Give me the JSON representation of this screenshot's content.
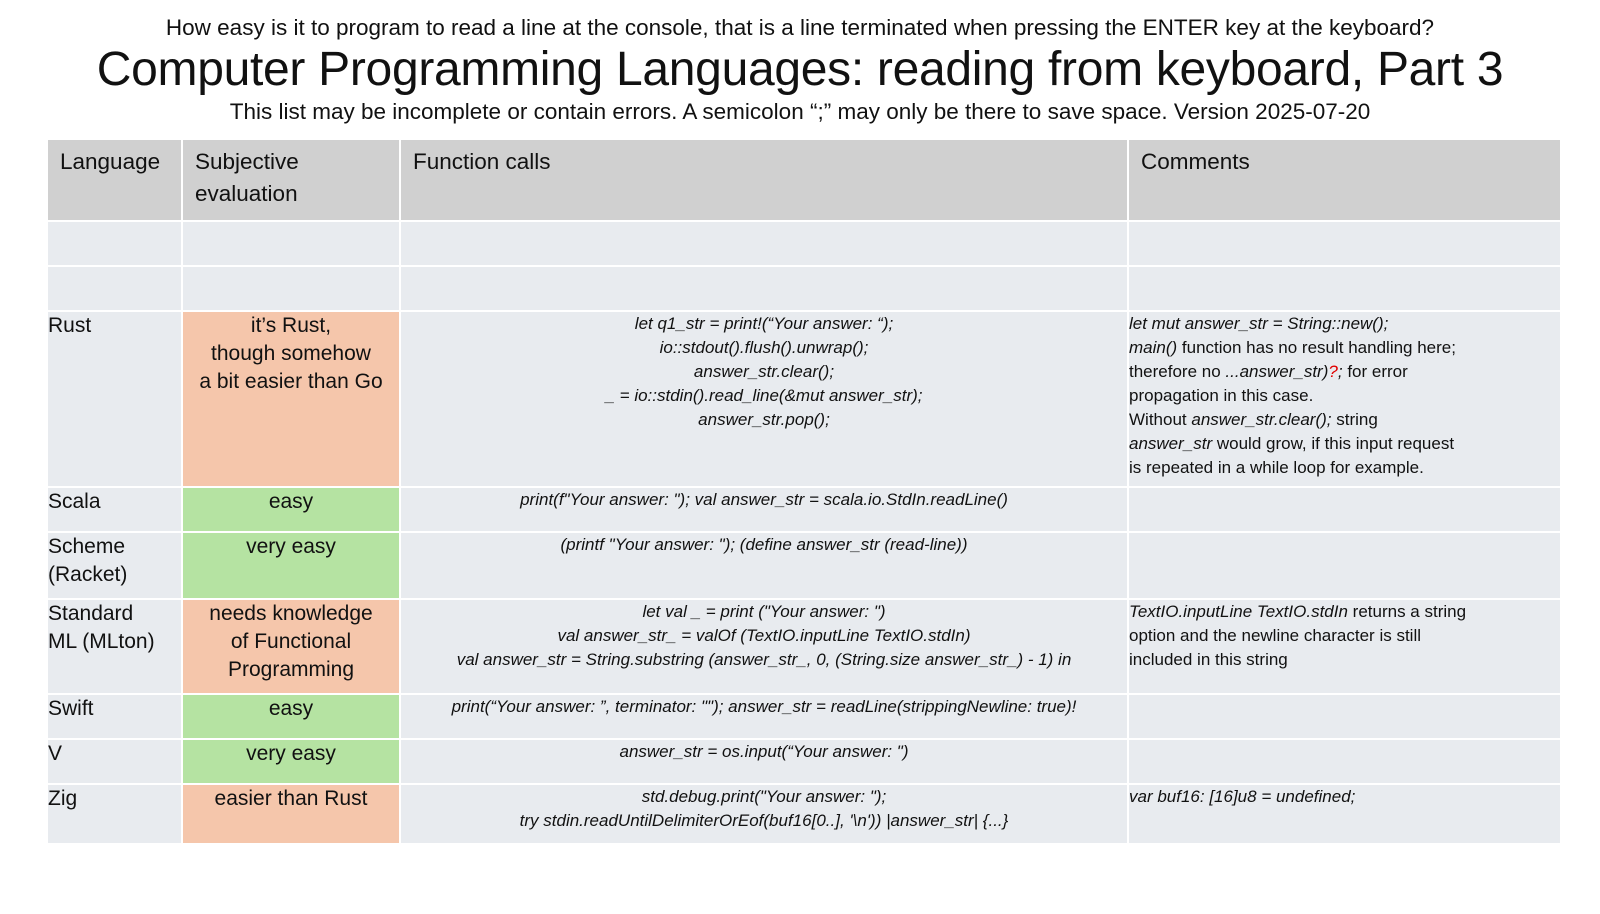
{
  "header": {
    "question": "How easy is it to program to read a line at the console, that is a line terminated when pressing the ENTER key at the keyboard?",
    "title": "Computer Programming Languages: reading from keyboard, Part 3",
    "subtitle": "This list may be incomplete or contain errors. A semicolon “;” may only be there to save space. Version 2025-07-20"
  },
  "columns": {
    "language": "Language",
    "evaluation_line1": "Subjective",
    "evaluation_line2": "evaluation",
    "calls": "Function calls",
    "comments": "Comments"
  },
  "colors": {
    "header_bg": "#d0d0d0",
    "cell_bg": "#e8ebef",
    "hard": "#f5c6ab",
    "easy": "#b5e3a2",
    "highlight": "#e00000"
  },
  "rows": {
    "rust": {
      "language": "Rust",
      "evaluation": [
        "it’s Rust,",
        "though somehow",
        "a bit easier than Go"
      ],
      "code": [
        "let q1_str = print!(“Your answer: “);",
        "io::stdout().flush().unwrap();",
        "answer_str.clear();",
        "_ = io::stdin().read_line(&mut answer_str);",
        "answer_str.pop();"
      ],
      "comment": {
        "l1": "let mut answer_str = String::new();",
        "l2_code": "main()",
        "l2_text": " function has no result handling here;",
        "l3_text": "therefore no ",
        "l3_code": "...answer_str)",
        "l3_red": "?",
        "l3_code2": ";",
        "l3_text2": " for error",
        "l4": "propagation in this case.",
        "l5_text": "Without ",
        "l5_code": "answer_str.clear();",
        "l5_text2": " string",
        "l6_code": "answer_str",
        "l6_text": " would grow, if this input request",
        "l7": "is repeated in a while loop for example."
      }
    },
    "scala": {
      "language": "Scala",
      "evaluation": "easy",
      "code": "print(f\"Your answer: \"); val answer_str = scala.io.StdIn.readLine()"
    },
    "scheme": {
      "language": [
        "Scheme",
        "(Racket)"
      ],
      "evaluation": "very easy",
      "code": "(printf \"Your answer: \"); (define answer_str (read-line))"
    },
    "sml": {
      "language": [
        "Standard",
        "ML (MLton)"
      ],
      "evaluation": [
        "needs knowledge",
        "of Functional",
        "Programming"
      ],
      "code": [
        "let val _ = print (\"Your answer: \")",
        "val answer_str_ = valOf (TextIO.inputLine TextIO.stdIn)",
        "val answer_str  = String.substring (answer_str_, 0, (String.size answer_str_) - 1) in"
      ],
      "comment": {
        "l1_code": "TextIO.inputLine TextIO.stdIn",
        "l1_text": " returns a string",
        "l2": "option and the newline character is still",
        "l3": "included in this string"
      }
    },
    "swift": {
      "language": "Swift",
      "evaluation": "easy",
      "code": "print(“Your answer: ”, terminator: \"\"); answer_str = readLine(strippingNewline: true)!"
    },
    "v": {
      "language": "V",
      "evaluation": "very easy",
      "code": "answer_str = os.input(“Your answer: \")"
    },
    "zig": {
      "language": "Zig",
      "evaluation": "easier than Rust",
      "code": [
        "std.debug.print(\"Your answer: \");",
        "try stdin.readUntilDelimiterOrEof(buf16[0..], '\\n')) |answer_str| {...}"
      ],
      "comment": "var buf16: [16]u8 = undefined;"
    }
  }
}
